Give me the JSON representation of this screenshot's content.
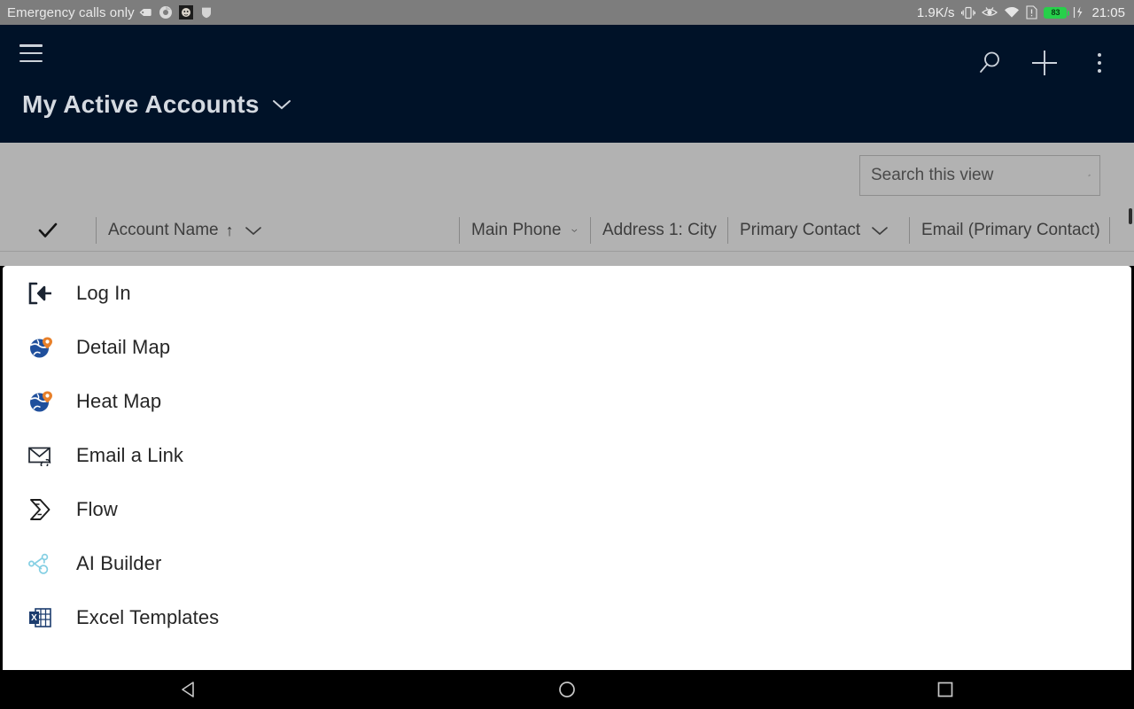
{
  "statusbar": {
    "carrier": "Emergency calls only",
    "notification_icons": [
      "tag-icon",
      "chrome-icon",
      "app-face-icon",
      "shield-icon"
    ],
    "data_rate": "1.9K/s",
    "right_icons": [
      "vibrate-icon",
      "eye-icon",
      "wifi-icon",
      "sim-icon"
    ],
    "battery_level": "83",
    "charging": true,
    "time": "21:05",
    "bg_color": "#7d7d7d"
  },
  "header": {
    "bg_color": "#001228",
    "menu_icon": "hamburger-icon",
    "view_title": "My Active Accounts",
    "view_chevron": "chevron-down-icon",
    "actions": [
      {
        "name": "search-button",
        "icon": "search-icon"
      },
      {
        "name": "new-record-button",
        "icon": "plus-icon"
      },
      {
        "name": "more-commands-button",
        "icon": "kebab-icon"
      }
    ]
  },
  "grid": {
    "bg_color": "#b2b2b2",
    "search": {
      "placeholder": "Search this view",
      "value": "",
      "icon": "search-icon"
    },
    "select_all_icon": "checkmark-icon",
    "columns": [
      {
        "label": "Account Name",
        "sorted": "asc",
        "sort_icon": "arrow-up-icon",
        "chevron": "chevron-down-icon"
      },
      {
        "label": "Main Phone",
        "sorted": "",
        "chevron": "chevron-down-icon"
      },
      {
        "label": "Address 1: City",
        "sorted": "",
        "chevron": "chevron-down-icon"
      },
      {
        "label": "Primary Contact",
        "sorted": "",
        "chevron": "chevron-down-icon"
      },
      {
        "label": "Email (Primary Contact)",
        "sorted": "",
        "chevron": "chevron-down-icon"
      }
    ]
  },
  "menu_sheet": {
    "items": [
      {
        "label": "Log In",
        "icon": "sign-in-icon"
      },
      {
        "label": "Detail Map",
        "icon": "globe-pin-icon"
      },
      {
        "label": "Heat Map",
        "icon": "globe-pin-icon"
      },
      {
        "label": "Email a Link",
        "icon": "email-link-icon"
      },
      {
        "label": "Flow",
        "icon": "flow-icon"
      },
      {
        "label": "AI Builder",
        "icon": "ai-builder-icon"
      },
      {
        "label": "Excel Templates",
        "icon": "excel-icon"
      }
    ]
  },
  "navbar": {
    "buttons": [
      {
        "name": "back-button",
        "icon": "triangle-back-icon"
      },
      {
        "name": "home-button",
        "icon": "circle-home-icon"
      },
      {
        "name": "recents-button",
        "icon": "square-recents-icon"
      }
    ]
  }
}
